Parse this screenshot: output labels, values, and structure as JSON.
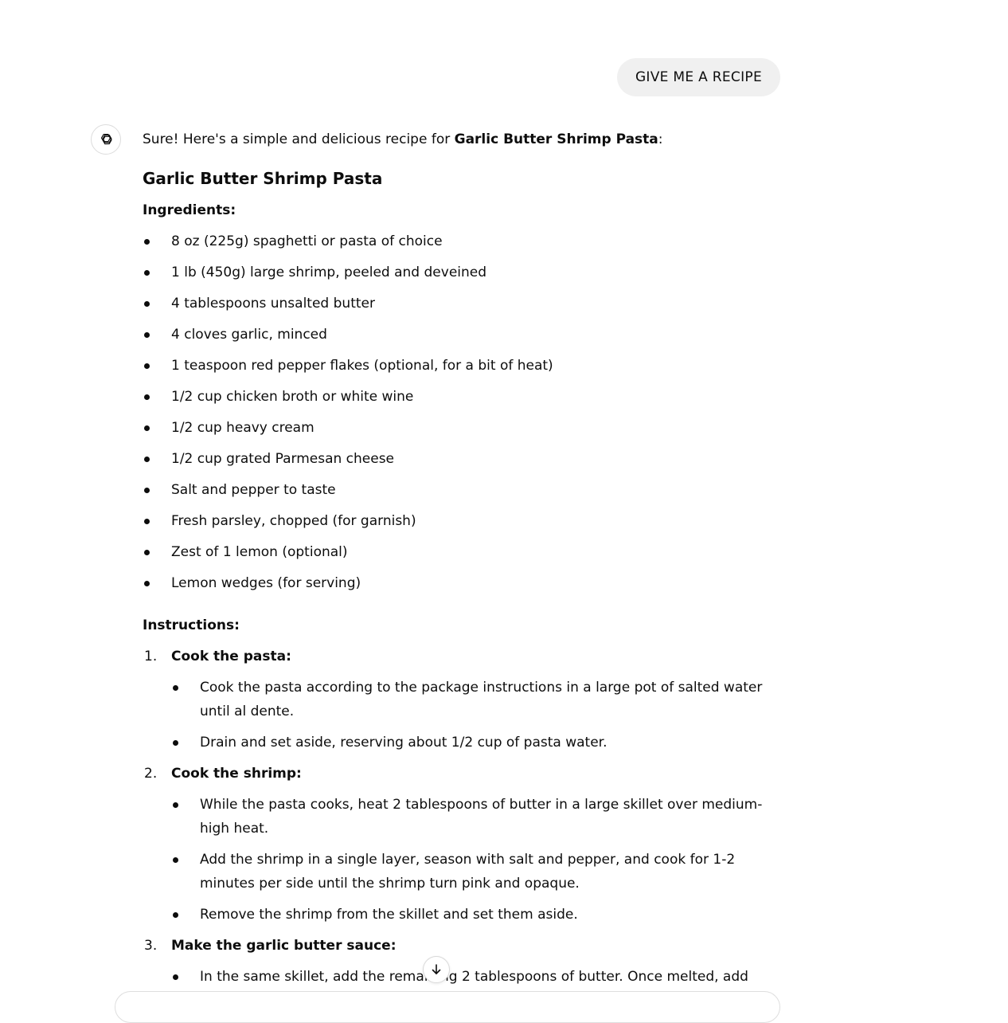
{
  "user_message": "GIVE ME A RECIPE",
  "assistant": {
    "avatar_icon": "openai-logo-icon",
    "intro_prefix": "Sure! Here's a simple and delicious recipe for ",
    "intro_bold": "Garlic Butter Shrimp Pasta",
    "intro_suffix": ":",
    "recipe_title": "Garlic Butter Shrimp Pasta",
    "ingredients_label": "Ingredients:",
    "ingredients": [
      "8 oz (225g) spaghetti or pasta of choice",
      "1 lb (450g) large shrimp, peeled and deveined",
      "4 tablespoons unsalted butter",
      "4 cloves garlic, minced",
      "1 teaspoon red pepper flakes (optional, for a bit of heat)",
      "1/2 cup chicken broth or white wine",
      "1/2 cup heavy cream",
      "1/2 cup grated Parmesan cheese",
      "Salt and pepper to taste",
      "Fresh parsley, chopped (for garnish)",
      "Zest of 1 lemon (optional)",
      "Lemon wedges (for serving)"
    ],
    "instructions_label": "Instructions:",
    "steps": [
      {
        "number": "1.",
        "title": "Cook the pasta:",
        "items": [
          "Cook the pasta according to the package instructions in a large pot of salted water until al dente.",
          "Drain and set aside, reserving about 1/2 cup of pasta water."
        ]
      },
      {
        "number": "2.",
        "title": "Cook the shrimp:",
        "items": [
          "While the pasta cooks, heat 2 tablespoons of butter in a large skillet over medium-high heat.",
          "Add the shrimp in a single layer, season with salt and pepper, and cook for 1-2 minutes per side until the shrimp turn pink and opaque.",
          "Remove the shrimp from the skillet and set them aside."
        ]
      },
      {
        "number": "3.",
        "title": "Make the garlic butter sauce:",
        "items": [
          "In the same skillet, add the remaining 2 tablespoons of butter. Once melted, add"
        ]
      }
    ]
  },
  "scroll_button_icon": "arrow-down-icon"
}
